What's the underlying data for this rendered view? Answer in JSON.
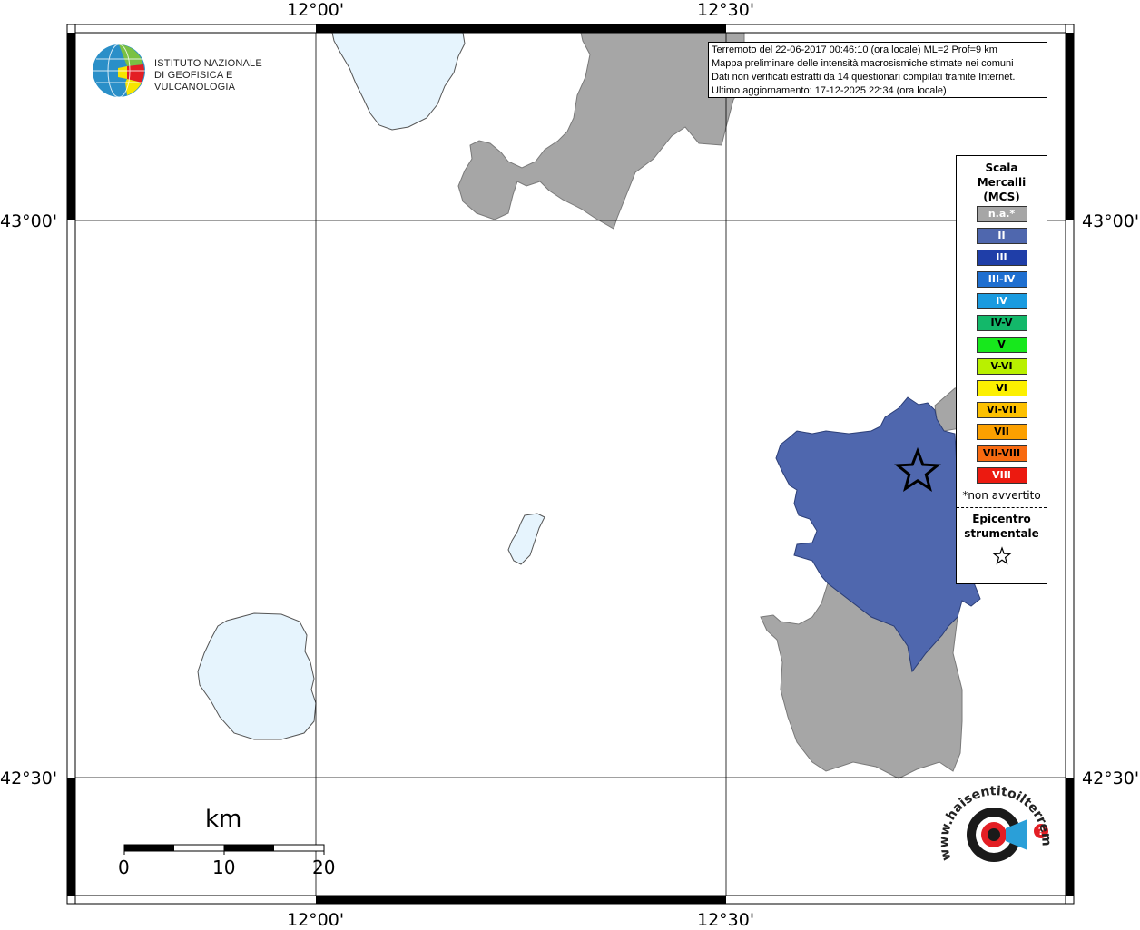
{
  "grid": {
    "lon_labels": [
      "12°00'",
      "12°30'"
    ],
    "lat_labels": [
      "43°00'",
      "42°30'"
    ]
  },
  "info": {
    "line1": "Terremoto del 22-06-2017 00:46:10 (ora locale) ML=2 Prof=9 km",
    "line2": "Mappa preliminare delle intensità macrosismiche stimate nei comuni",
    "line3": "Dati non verificati estratti da 14 questionari compilati tramite Internet.",
    "line4": "Ultimo aggiornamento: 17-12-2025 22:34 (ora locale)"
  },
  "legend": {
    "title_line1": "Scala",
    "title_line2": "Mercalli",
    "title_line3": "(MCS)",
    "items": [
      {
        "label": "n.a.*",
        "color": "#a6a6a6",
        "dark": false
      },
      {
        "label": "II",
        "color": "#4f67ae",
        "dark": false
      },
      {
        "label": "III",
        "color": "#1f3ea8",
        "dark": false
      },
      {
        "label": "III-IV",
        "color": "#1f6fd0",
        "dark": false
      },
      {
        "label": "IV",
        "color": "#1a9be0",
        "dark": false
      },
      {
        "label": "IV-V",
        "color": "#13b86a",
        "dark": true
      },
      {
        "label": "V",
        "color": "#17e81c",
        "dark": true
      },
      {
        "label": "V-VI",
        "color": "#b9f000",
        "dark": true
      },
      {
        "label": "VI",
        "color": "#fcf000",
        "dark": true
      },
      {
        "label": "VI-VII",
        "color": "#fcc000",
        "dark": true
      },
      {
        "label": "VII",
        "color": "#fca000",
        "dark": true
      },
      {
        "label": "VII-VIII",
        "color": "#f86a10",
        "dark": true
      },
      {
        "label": "VIII",
        "color": "#ec1a10",
        "dark": false
      }
    ],
    "note": "*non avvertito",
    "epicenter_line1": "Epicentro",
    "epicenter_line2": "strumentale"
  },
  "logo": {
    "ingv_line1": "ISTITUTO NAZIONALE",
    "ingv_line2": "DI GEOFISICA E VULCANOLOGIA",
    "hsit_text": "www.haisentitoilterremoto.it"
  },
  "scalebar": {
    "unit": "km",
    "ticks": [
      "0",
      "10",
      "20"
    ]
  },
  "colors": {
    "water": "#e6f4fd",
    "na_area": "#a6a6a6",
    "intensity_II": "#4f67ae"
  }
}
